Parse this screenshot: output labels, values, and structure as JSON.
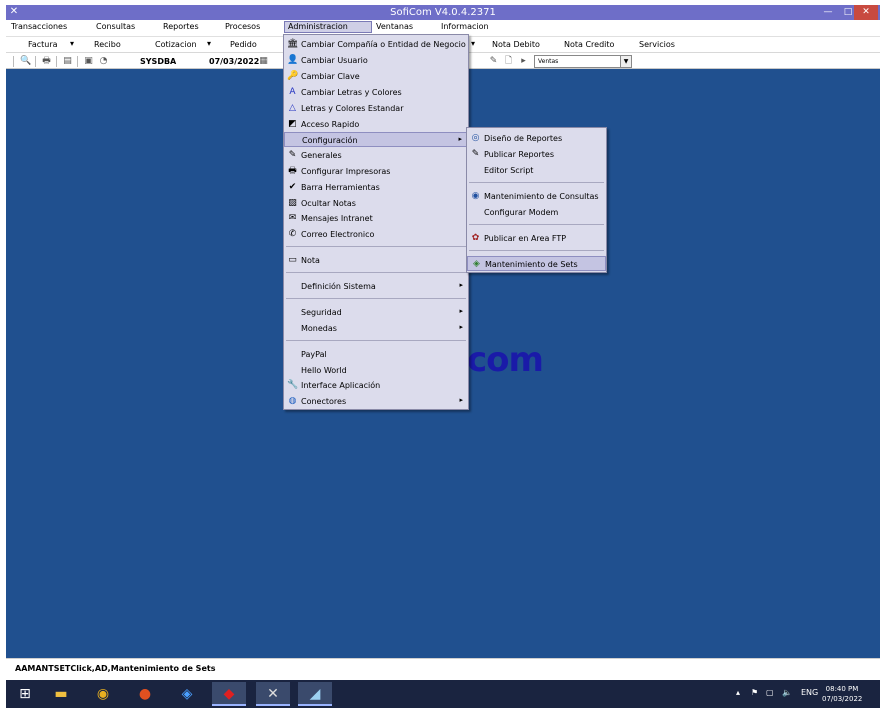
{
  "window": {
    "title": "SofiCom V4.0.4.2371"
  },
  "menubar": [
    "Transacciones",
    "Consultas",
    "Reportes",
    "Procesos",
    "Administracion",
    "Ventanas",
    "Informacion"
  ],
  "toolbar1": {
    "items": [
      "Factura",
      "Recibo",
      "Cotizacion",
      "Pedido",
      "Nota Debito",
      "Nota Credito",
      "Servicios"
    ]
  },
  "toolbar2": {
    "user": "SYSDBA",
    "date": "07/03/2022",
    "combo_value": "Ventas"
  },
  "desktop": {
    "logo_text": "com",
    "background_color": "#20508f"
  },
  "admin_menu": {
    "items": [
      {
        "label": "Cambiar Compañía o Entidad de Negocio",
        "icon": "company-icon"
      },
      {
        "label": "Cambiar Usuario",
        "icon": "user-icon"
      },
      {
        "label": "Cambiar Clave",
        "icon": "key-icon"
      },
      {
        "label": "Cambiar Letras y Colores",
        "icon": "font-color-icon"
      },
      {
        "label": "Letras y Colores Estandar",
        "icon": "font-standard-icon"
      },
      {
        "label": "Acceso Rapido",
        "icon": "shortcut-icon"
      },
      {
        "label": "Configuración",
        "icon": "",
        "submenu": true,
        "highlighted": true
      },
      {
        "label": "Generales",
        "icon": "tools-icon"
      },
      {
        "label": "Configurar Impresoras",
        "icon": "printer-icon"
      },
      {
        "label": "Barra Herramientas",
        "icon": "check-icon"
      },
      {
        "label": "Ocultar Notas",
        "icon": "hide-notes-icon"
      },
      {
        "label": "Mensajes Intranet",
        "icon": "message-icon"
      },
      {
        "label": "Correo Electronico",
        "icon": "mail-icon"
      },
      {
        "label": "Nota",
        "icon": "note-icon"
      },
      {
        "label": "Definición Sistema",
        "icon": "",
        "submenu": true
      },
      {
        "label": "Seguridad",
        "icon": "",
        "submenu": true
      },
      {
        "label": "Monedas",
        "icon": "",
        "submenu": true
      },
      {
        "label": "PayPal",
        "icon": ""
      },
      {
        "label": "Hello World",
        "icon": ""
      },
      {
        "label": "Interface Aplicación",
        "icon": "interface-icon"
      },
      {
        "label": "Conectores",
        "icon": "connector-icon",
        "submenu": true
      }
    ]
  },
  "config_submenu": {
    "items": [
      {
        "label": "Diseño de Reportes",
        "icon": "report-design-icon"
      },
      {
        "label": "Publicar Reportes",
        "icon": "publish-icon"
      },
      {
        "label": "Editor Script",
        "icon": ""
      },
      {
        "label": "Mantenimiento de Consultas",
        "icon": "query-icon"
      },
      {
        "label": "Configurar Modem",
        "icon": ""
      },
      {
        "label": "Publicar en Area FTP",
        "icon": "ftp-icon"
      },
      {
        "label": "Mantenimiento de Sets",
        "icon": "sets-icon",
        "highlighted": true
      }
    ]
  },
  "statusbar": {
    "text": "AAMANTSETClick,AD,Mantenimiento de Sets"
  },
  "taskbar": {
    "lang": "ENG",
    "time": "08:40 PM",
    "date": "07/03/2022"
  }
}
